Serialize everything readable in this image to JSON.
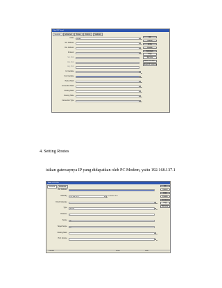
{
  "figure1": {
    "window_title": "New IPIP Tunnel",
    "tabs": [
      "General",
      "Advanced",
      "Status",
      "Actions",
      "Statistics"
    ],
    "fields": [
      {
        "label": "Chain:",
        "value": "srcnat",
        "control": "dropdown",
        "dim": false
      },
      {
        "label": "Src. Address:",
        "value": "",
        "control": "dropdown",
        "dim": false
      },
      {
        "label": "Dst. Address:",
        "value": "",
        "control": "dropdown",
        "dim": false
      },
      {
        "label": "Protocol:",
        "value": "",
        "control": "dropdown",
        "dim": false
      },
      {
        "label": "Src. Port:",
        "value": "",
        "control": "none",
        "dim": true
      },
      {
        "label": "Dst. Port:",
        "value": "",
        "control": "none",
        "dim": true
      },
      {
        "label": "Any. Port:",
        "value": "",
        "control": "none",
        "dim": true
      },
      {
        "label": "In. Interface:",
        "value": "",
        "control": "dropdown",
        "dim": false
      },
      {
        "label": "Out. Interface:",
        "value": "",
        "control": "dropdown",
        "dim": false,
        "selected": true
      },
      {
        "label": "Packet Mark:",
        "value": "",
        "control": "dropdown",
        "dim": false
      },
      {
        "label": "Connection Mark:",
        "value": "",
        "control": "dropdown",
        "dim": false
      },
      {
        "label": "Routing Mark:",
        "value": "",
        "control": "dropdown",
        "dim": false
      },
      {
        "label": "Routing Table:",
        "value": "",
        "control": "dropdown",
        "dim": false
      },
      {
        "label": "Connection Type:",
        "value": "",
        "control": "dropdown",
        "dim": false
      }
    ],
    "buttons": [
      "OK",
      "Cancel",
      "Apply",
      "Disable",
      "Comment",
      "Copy",
      "Remove",
      "Reset Counters",
      "Reset All Counters"
    ]
  },
  "section_heading": "4.  Setting Routes",
  "paragraph": "isikan gatewaynya IP yang didapatkan oleh PC Modem, yaitu 192.168.137.1",
  "figure2": {
    "window_title": "Route <0.0.0.0/0>",
    "tabs": [
      "General",
      "Attributes"
    ],
    "fields": [
      {
        "label": "Dst. Address:",
        "value": "",
        "control": "none",
        "selected": true
      },
      {
        "label": "Gateway:",
        "value": "192.168.137.1",
        "control": "dropdown",
        "unit": "reachable ether"
      },
      {
        "label": "Check Gateway:",
        "value": "",
        "control": "dropdown"
      },
      {
        "label": "Type:",
        "value": "unicast",
        "control": "dropdown"
      },
      {
        "label": "Distance:",
        "value": "1",
        "control": "none"
      },
      {
        "label": "Scope:",
        "value": "30",
        "control": "none"
      },
      {
        "label": "Target Scope:",
        "value": "10",
        "control": "none"
      },
      {
        "label": "Routing Mark:",
        "value": "",
        "control": "dropdown"
      },
      {
        "label": "Pref. Source:",
        "value": "",
        "control": "dropdown"
      }
    ],
    "buttons": [
      "OK",
      "Cancel",
      "Apply",
      "Disable",
      "Comment",
      "Copy",
      "Remove"
    ],
    "status": [
      "enabled",
      "active",
      "static"
    ]
  }
}
